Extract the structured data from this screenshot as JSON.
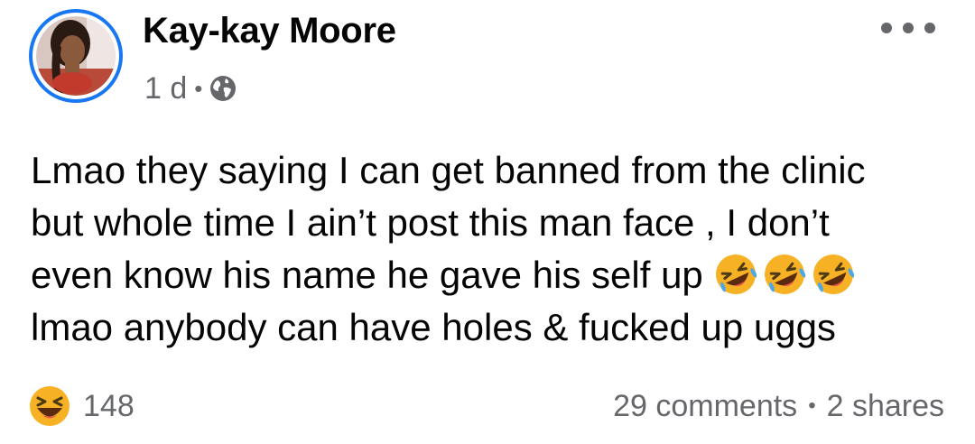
{
  "post": {
    "author_name": "Kay-kay Moore",
    "time_ago": "1 d",
    "meta_separator": "•",
    "audience_icon": "globe-icon",
    "more_icon": "more-options-icon",
    "text_lines": [
      "Lmao they saying I can get banned from the clinic",
      "but whole time I ain’t post this man face , I don’t",
      "even know his name he gave his self up ",
      "lmao anybody can have holes & fucked up uggs"
    ],
    "emoji_name": "rolling-on-floor-laughing-emoji",
    "emoji_count": 3
  },
  "footer": {
    "reaction_icon": "haha-reaction-icon",
    "reaction_count": "148",
    "comments_text": "29 comments",
    "separator": "•",
    "shares_text": "2 shares"
  },
  "colors": {
    "avatar_ring": "#1877f2",
    "secondary_text": "#65676b",
    "primary_text": "#050505",
    "emoji_yellow": "#f7b125"
  }
}
